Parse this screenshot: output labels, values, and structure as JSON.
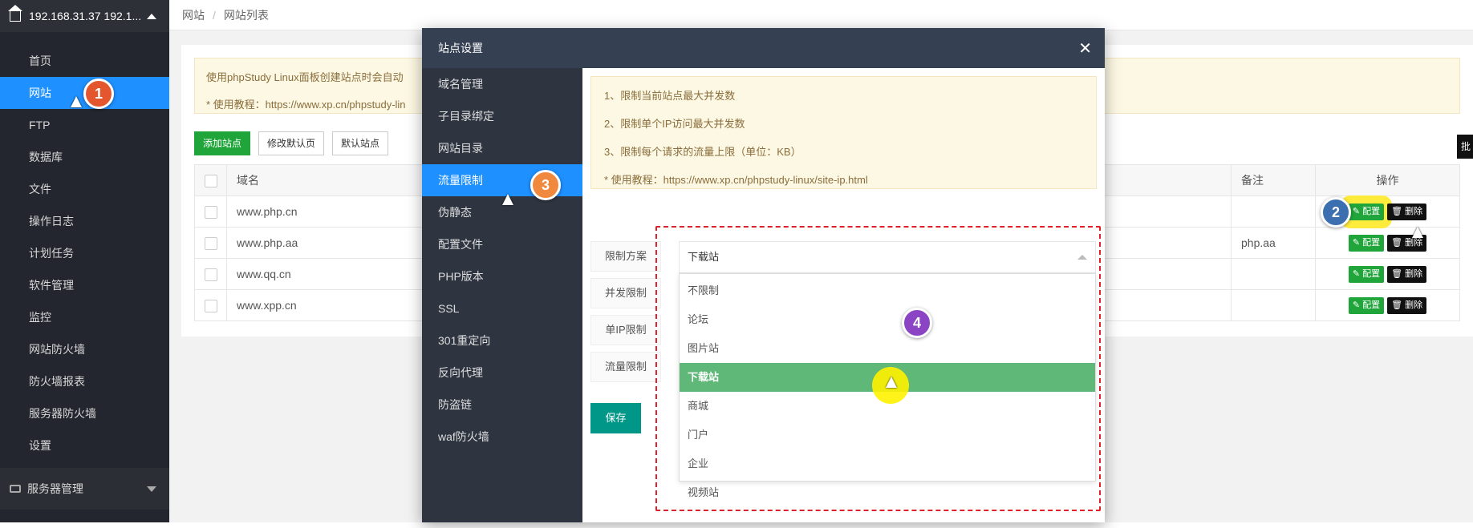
{
  "server": {
    "title": "192.168.31.37 192.1..."
  },
  "sidebar": {
    "items": [
      "首页",
      "网站",
      "FTP",
      "数据库",
      "文件",
      "操作日志",
      "计划任务",
      "软件管理",
      "监控",
      "网站防火墙",
      "防火墙报表",
      "服务器防火墙",
      "设置"
    ],
    "active_index": 1,
    "bottom": "服务器管理"
  },
  "breadcrumb": {
    "root": "网站",
    "current": "网站列表"
  },
  "notice": {
    "line1": "使用phpStudy Linux面板创建站点时会自动",
    "line2": "* 使用教程：https://www.xp.cn/phpstudy-lin"
  },
  "toolbar": {
    "add": "添加站点",
    "edit_default": "修改默认页",
    "default_site": "默认站点",
    "batch": "批"
  },
  "table": {
    "headers": {
      "domain": "域名",
      "note": "备注",
      "op": "操作"
    },
    "rows": [
      {
        "domain": "www.php.cn",
        "note": ""
      },
      {
        "domain": "www.php.aa",
        "note": "php.aa"
      },
      {
        "domain": "www.qq.cn",
        "note": ""
      },
      {
        "domain": "www.xpp.cn",
        "note": ""
      }
    ],
    "cfg_label": "配置",
    "del_label": "删除"
  },
  "modal": {
    "title": "站点设置",
    "nav": [
      "域名管理",
      "子目录绑定",
      "网站目录",
      "流量限制",
      "伪静态",
      "配置文件",
      "PHP版本",
      "SSL",
      "301重定向",
      "反向代理",
      "防盗链",
      "waf防火墙"
    ],
    "active_index": 3,
    "tips": [
      "1、限制当前站点最大并发数",
      "2、限制单个IP访问最大并发数",
      "3、限制每个请求的流量上限（单位：KB）",
      "* 使用教程：https://www.xp.cn/phpstudy-linux/site-ip.html"
    ],
    "labels": {
      "plan": "限制方案",
      "concurrency": "并发限制",
      "single_ip": "单IP限制",
      "traffic": "流量限制"
    },
    "select_value": "下载站",
    "options": [
      "不限制",
      "论坛",
      "图片站",
      "下载站",
      "商城",
      "门户",
      "企业",
      "视频站"
    ],
    "selected_index": 3,
    "save": "保存"
  },
  "steps": [
    "1",
    "2",
    "3",
    "4"
  ]
}
